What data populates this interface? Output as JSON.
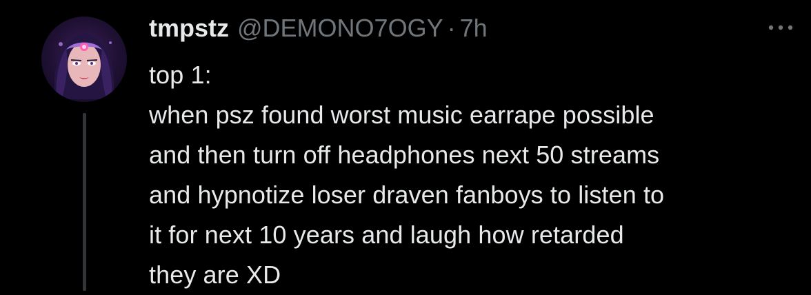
{
  "tweet": {
    "display_name": "tmpstz",
    "handle": "@DEMONO7OGY",
    "separator": "·",
    "time": "7h",
    "text_lines": [
      "top 1:",
      "when psz found worst music earrape possible",
      "and then turn off headphones next 50 streams",
      "and hypnotize loser draven fanboys to listen to",
      "it for next 10 years and laugh how retarded",
      "they are XD"
    ]
  },
  "icons": {
    "more": "more-horizontal-icon",
    "avatar": "avatar-image"
  },
  "colors": {
    "background": "#000000",
    "primary_text": "#e7e9ea",
    "secondary_text": "#71767b",
    "thread_line": "#333639"
  }
}
